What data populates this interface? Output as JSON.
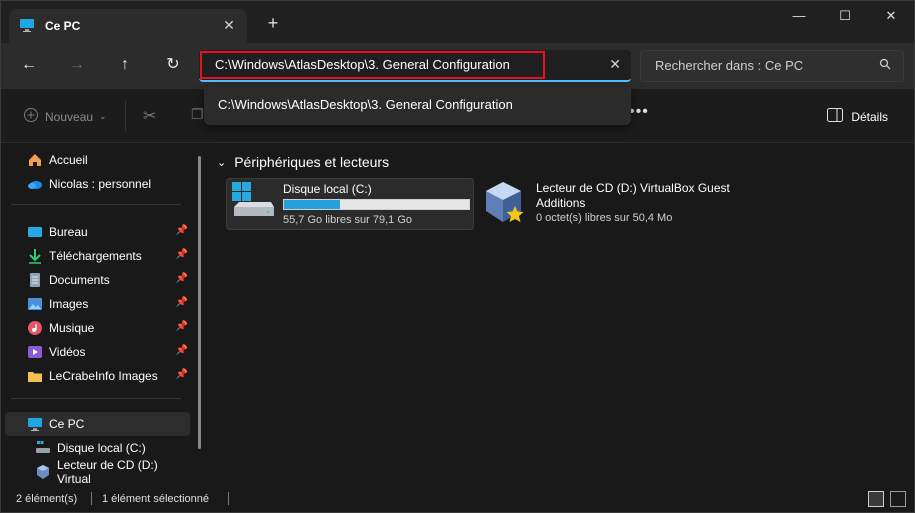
{
  "window": {
    "tab_title": "Ce PC",
    "new_tab": "+",
    "controls": {
      "minimize": "—",
      "maximize": "☐",
      "close": "✕"
    }
  },
  "nav": {
    "address_value": "C:\\Windows\\AtlasDesktop\\3. General Configuration",
    "clear_symbol": "✕",
    "search_placeholder": "Rechercher dans : Ce PC"
  },
  "dropdown": {
    "items": [
      "C:\\Windows\\AtlasDesktop\\3. General Configuration"
    ]
  },
  "toolbar": {
    "new_label": "Nouveau",
    "more_label": "•••",
    "details_label": "Détails"
  },
  "sidebar": {
    "items": [
      {
        "label": "Accueil"
      },
      {
        "label": "Nicolas : personnel"
      },
      {
        "label": "Bureau"
      },
      {
        "label": "Téléchargements"
      },
      {
        "label": "Documents"
      },
      {
        "label": "Images"
      },
      {
        "label": "Musique"
      },
      {
        "label": "Vidéos"
      },
      {
        "label": "LeCrabeInfo Images"
      },
      {
        "label": "Ce PC"
      },
      {
        "label": "Disque local (C:)"
      },
      {
        "label": "Lecteur de CD (D:) Virtual"
      }
    ]
  },
  "main": {
    "section_title": "Périphériques et lecteurs",
    "drives": [
      {
        "name": "Disque local (C:)",
        "free_text": "55,7 Go libres sur 79,1 Go",
        "used_fraction": 0.3
      },
      {
        "name": "Lecteur de CD (D:) VirtualBox Guest Additions",
        "free_text": "0 octet(s) libres sur 50,4 Mo"
      }
    ]
  },
  "status": {
    "count": "2 élément(s)",
    "selected": "1 élément sélectionné"
  },
  "colors": {
    "accent": "#4cc2ff",
    "highlight_border": "#e81123",
    "drive_fill": "#26a0da"
  }
}
